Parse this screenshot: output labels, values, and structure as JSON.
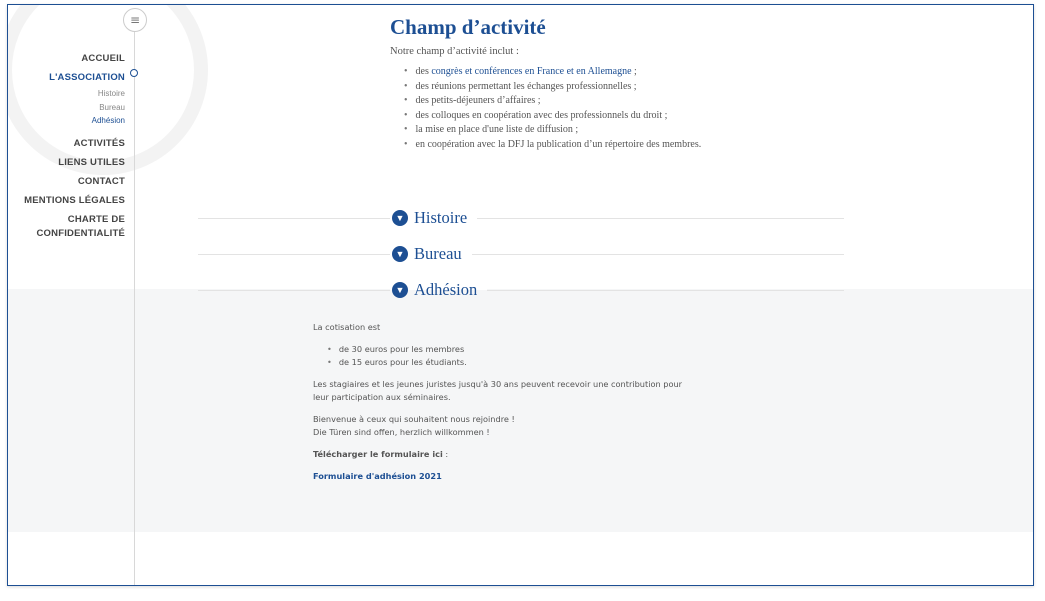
{
  "sidebar": {
    "menu_icon": "hamburger-icon",
    "items": [
      {
        "label": "ACCUEIL"
      },
      {
        "label": "L'ASSOCIATION",
        "active": true,
        "children": [
          {
            "label": "Histoire"
          },
          {
            "label": "Bureau"
          },
          {
            "label": "Adhésion",
            "active": true
          }
        ]
      },
      {
        "label": "ACTIVITÉS"
      },
      {
        "label": "LIENS UTILES"
      },
      {
        "label": "CONTACT"
      },
      {
        "label": "MENTIONS LÉGALES"
      },
      {
        "label": "CHARTE DE CONFIDENTIALITÉ"
      }
    ]
  },
  "main": {
    "title": "Champ d’activité",
    "intro": "Notre champ d’activité inclut :",
    "list": [
      {
        "prefix": "des ",
        "link": "congrès et conférences en France et en Allemagne",
        "suffix": " ;"
      },
      {
        "text": "des réunions permettant les échanges professionnelles ;"
      },
      {
        "text": "des petits-déjeuners d’affaires ;"
      },
      {
        "text": "des colloques en coopération avec des professionnels du droit ;"
      },
      {
        "text": "la mise en place d'une liste de diffusion ;"
      },
      {
        "text": "en coopération avec la DFJ la publication d’un répertoire des membres."
      }
    ]
  },
  "accordions": [
    {
      "label": "Histoire",
      "icon": "chevron-down-circle-icon",
      "expanded": false
    },
    {
      "label": "Bureau",
      "icon": "chevron-down-circle-icon",
      "expanded": false
    },
    {
      "label": "Adhésion",
      "icon": "chevron-down-circle-icon",
      "expanded": true
    }
  ],
  "adhesion": {
    "intro": "La cotisation est",
    "fees": [
      "de 30 euros pour les membres",
      "de 15 euros pour les étudiants."
    ],
    "contribution": "Les stagiaires et les jeunes juristes jusqu'à 30 ans peuvent recevoir une contribution pour leur participation aux séminaires.",
    "welcome_fr": "Bienvenue à ceux qui souhaitent nous rejoindre !",
    "welcome_de": "Die Türen sind offen, herzlich willkommen !",
    "download_label": "Télécharger le formulaire ici",
    "download_suffix": " :",
    "form_link": "Formulaire d'adhésion 2021"
  },
  "colors": {
    "accent": "#1d4f93",
    "section_bg": "#f5f6f7"
  }
}
